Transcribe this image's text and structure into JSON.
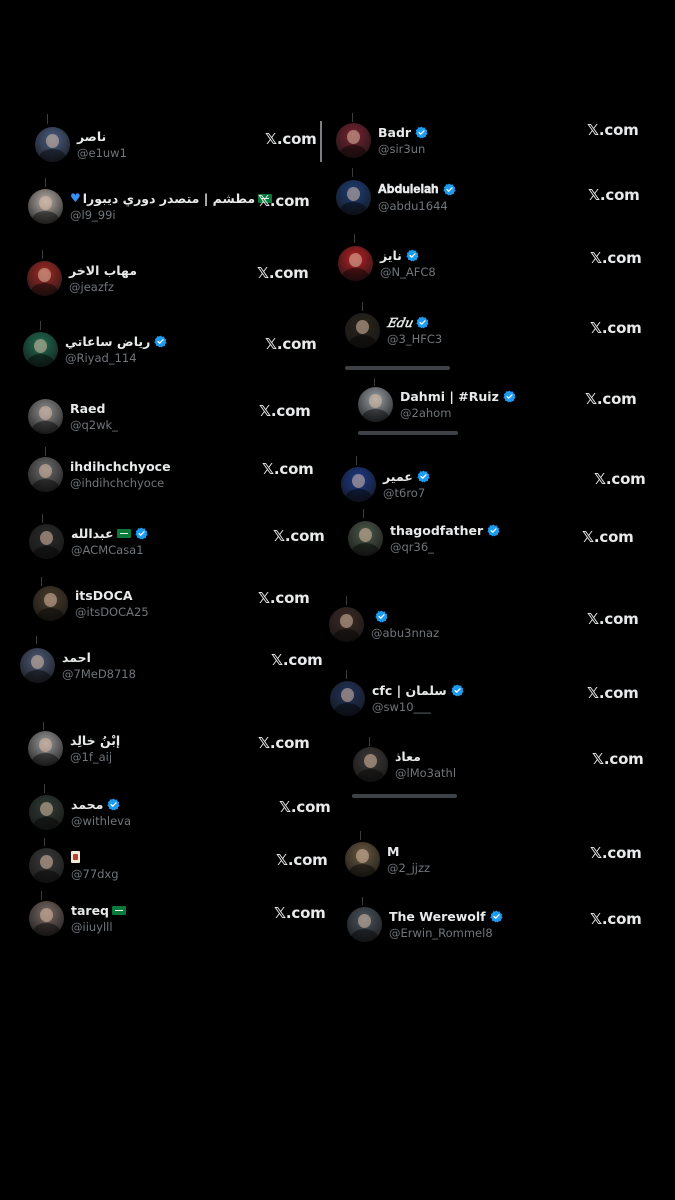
{
  "accent": "#1d9bf0",
  "link_text": "𝕏.com",
  "left_column": [
    {
      "name": "ناصر",
      "handle": "@e1uw1",
      "verified": false,
      "avatar_color": "#4b5f86"
    },
    {
      "name": "مطشم | متصدر دوري ديبورا",
      "prefix_heart": true,
      "flag": true,
      "flag_position": "after",
      "handle": "@l9_99i",
      "verified": false,
      "avatar_color": "#b8b0aa"
    },
    {
      "name": "مهاب الاخر",
      "handle": "@jeazfz",
      "verified": false,
      "avatar_color": "#a72a25"
    },
    {
      "name": "رياض ساعاتي",
      "handle": "@Riyad_114",
      "verified": true,
      "avatar_color": "#1f6e53"
    },
    {
      "name": "Raed",
      "handle": "@q2wk_",
      "verified": false,
      "avatar_color": "#8f8f8f"
    },
    {
      "name": "ihdihchchyoce",
      "handle": "@ihdihchchyoce",
      "verified": false,
      "avatar_color": "#6d6d6d"
    },
    {
      "name": "عبدالله",
      "flag": true,
      "flag_position": "after",
      "handle": "@ACMCasa1",
      "verified": true,
      "avatar_color": "#2a2a2a"
    },
    {
      "name": "itsDOCA",
      "handle": "@itsDOCA25",
      "verified": false,
      "avatar_color": "#4a3b2a"
    },
    {
      "name": "احمد",
      "handle": "@7MeD8718",
      "verified": false,
      "avatar_color": "#4d5a78"
    },
    {
      "name": "إبْنُ خالِد",
      "handle": "@1f_aij",
      "verified": false,
      "avatar_color": "#9a9a9a"
    },
    {
      "name": "محمد",
      "handle": "@withleva",
      "verified": true,
      "avatar_color": "#2f3b34"
    },
    {
      "name": "",
      "card_emoji": true,
      "handle": "@77dxg",
      "verified": false,
      "avatar_color": "#3a3a3a"
    },
    {
      "name": "tareq",
      "flag": true,
      "flag_position": "after",
      "handle": "@iiuylll",
      "verified": false,
      "avatar_color": "#7a6a65"
    }
  ],
  "right_column": [
    {
      "name": "Badr",
      "handle": "@sir3un",
      "verified": true,
      "avatar_color": "#7a2230"
    },
    {
      "name": "𝐀𝐛𝐝𝐮𝐥𝐞𝐥𝐚𝐡",
      "handle": "@abdu1644",
      "verified": true,
      "avatar_color": "#1d3f7a"
    },
    {
      "name": "نايز",
      "handle": "@N_AFC8",
      "verified": true,
      "avatar_color": "#b81f24"
    },
    {
      "name": "𝐸𝑑𝑢",
      "handle": "@3_HFC3",
      "verified": true,
      "avatar_color": "#2a241c"
    },
    {
      "name": "Dahmi | #Ruiz",
      "handle": "@2ahom",
      "verified": true,
      "avatar_color": "#9aa0a6"
    },
    {
      "name": "عمير",
      "handle": "@t6ro7",
      "verified": true,
      "avatar_color": "#1b3a8c"
    },
    {
      "name": "thagodfather",
      "handle": "@qr36_",
      "verified": true,
      "avatar_color": "#4c5a4a"
    },
    {
      "name": "",
      "handle": "@abu3nnaz",
      "verified": true,
      "avatar_color": "#3b2a25"
    },
    {
      "name": "cfc | سلمان",
      "handle": "@sw10___",
      "verified": true,
      "avatar_color": "#20335c"
    },
    {
      "name": "معاذ",
      "handle": "@lMo3athl",
      "verified": false,
      "avatar_color": "#3c3836"
    },
    {
      "name": "M",
      "handle": "@2_jjzz",
      "verified": false,
      "avatar_color": "#6a5a40"
    },
    {
      "name": "The Werewolf",
      "handle": "@Erwin_Rommel8",
      "verified": true,
      "avatar_color": "#4a5560"
    }
  ]
}
